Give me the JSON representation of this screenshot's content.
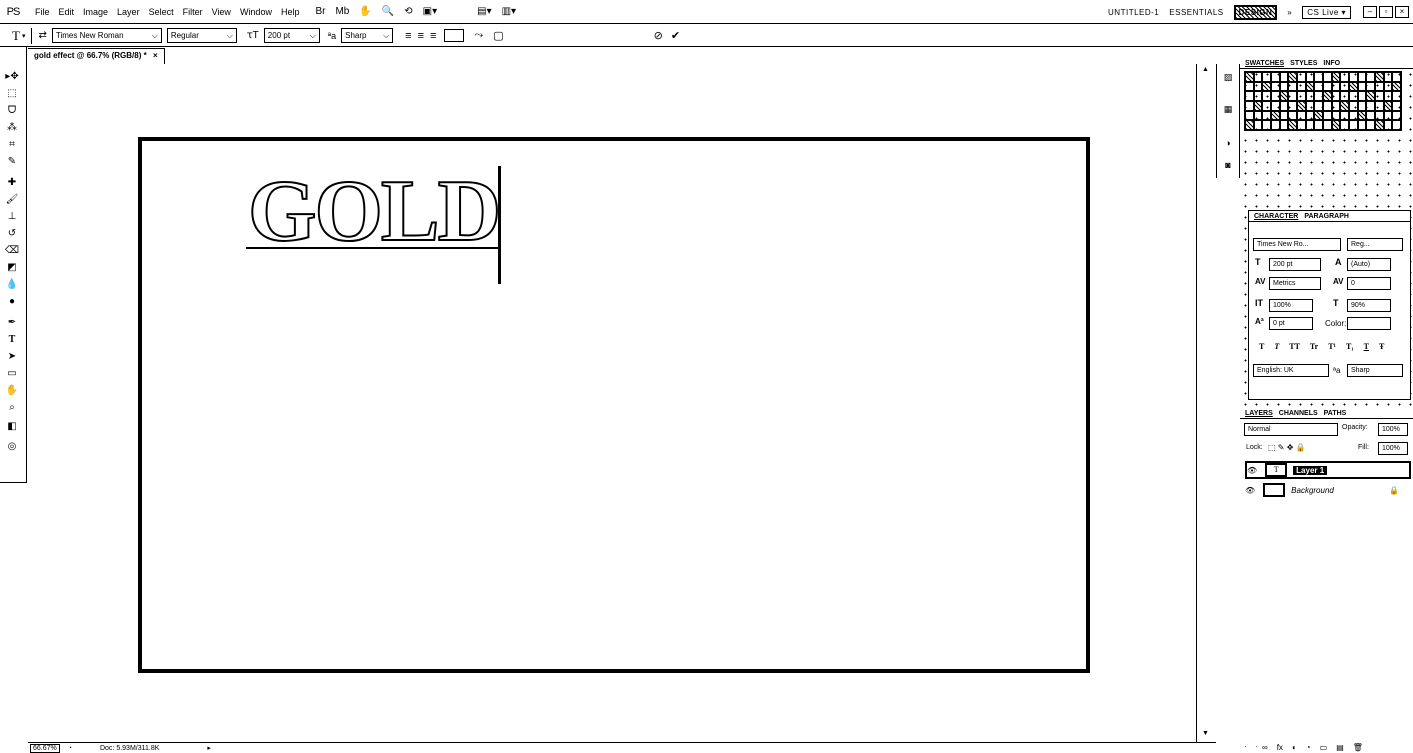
{
  "app": {
    "logo": "PS"
  },
  "menu": [
    "File",
    "Edit",
    "Image",
    "Layer",
    "Select",
    "Filter",
    "View",
    "Window",
    "Help"
  ],
  "workspace": {
    "items": [
      "UNTITLED-1",
      "ESSENTIALS",
      "DESIGN"
    ],
    "more": "»",
    "cslive": "CS Live ▾"
  },
  "options": {
    "font_family": "Times New Roman",
    "font_style": "Regular",
    "font_size": "200 pt",
    "antialias": "Sharp",
    "cancel": "⊘",
    "commit": "✔"
  },
  "document": {
    "tab_title": "gold effect @ 66.7% (RGB/8) *",
    "close": "×",
    "text": "GOLD",
    "zoom": "66.67%",
    "doc_info": "Doc: 5.93M/311.8K"
  },
  "panels": {
    "swatches_tabs": [
      "SWATCHES",
      "STYLES",
      "INFO"
    ],
    "character_tabs": [
      "CHARACTER",
      "PARAGRAPH"
    ],
    "character": {
      "font": "Times New Ro...",
      "style": "Reg...",
      "size": "200 pt",
      "leading": "(Auto)",
      "kerning": "Metrics",
      "tracking": "0",
      "vscale": "100%",
      "hscale": "90%",
      "baseline": "0 pt",
      "color_label": "Color:",
      "language": "English: UK",
      "antialias": "Sharp",
      "type_buttons": [
        "T",
        "T",
        "TT",
        "Tr",
        "T¹",
        "T₁",
        "T",
        "Ŧ"
      ]
    },
    "layers_tabs": [
      "LAYERS",
      "CHANNELS",
      "PATHS"
    ],
    "layers": {
      "blend_mode": "Normal",
      "opacity_label": "Opacity:",
      "opacity": "100%",
      "lock_label": "Lock:",
      "fill_label": "Fill:",
      "fill": "100%",
      "items": [
        {
          "name": "Layer 1",
          "thumb": "T",
          "selected": true
        },
        {
          "name": "Background",
          "thumb": "",
          "selected": false
        }
      ],
      "footer_icons": [
        "∞",
        "fx",
        "◐",
        "◔",
        "▭",
        "▤",
        "🗑"
      ]
    }
  }
}
